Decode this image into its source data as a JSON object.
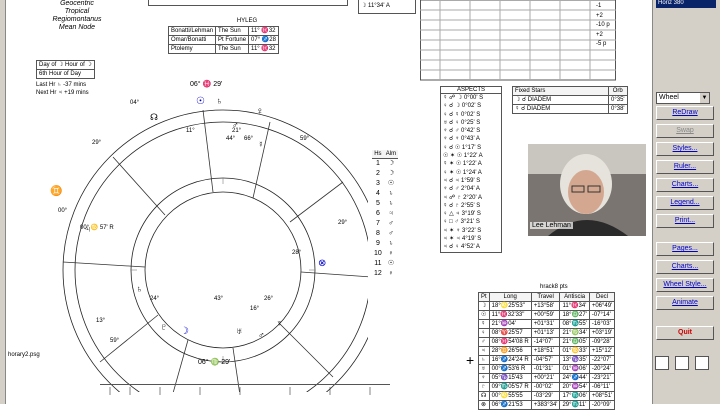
{
  "info_lines": [
    "Geocentric",
    "Tropical",
    "Regiomontanus",
    "Mean Node"
  ],
  "hyleg": {
    "title": "HYLEG",
    "rows": [
      [
        "Bonatti/Lehman",
        "The Sun",
        "11° ♓32"
      ],
      [
        "Omar/Bonatti",
        "Pt Fortune",
        "07° ♐28"
      ],
      [
        "Ptolemy",
        "The Sun",
        "11° ♓32"
      ]
    ]
  },
  "day_hour": {
    "day_label": "Day of ☽ Hour of ☽",
    "hour_label": "6th Hour of Day",
    "last_hr": "Last Hr ♄ -37 mins",
    "next_hr": "Next Hr ♃ +19 mins"
  },
  "houses": {
    "header": [
      "Hs",
      "Alm"
    ],
    "rows": [
      [
        "1",
        "☽"
      ],
      [
        "2",
        "☽"
      ],
      [
        "3",
        "☉"
      ],
      [
        "4",
        "♄"
      ],
      [
        "5",
        "♄"
      ],
      [
        "6",
        "♃"
      ],
      [
        "7",
        "♂"
      ],
      [
        "8",
        "♂"
      ],
      [
        "9",
        "♄"
      ],
      [
        "10",
        "♀"
      ],
      [
        "11",
        "☉"
      ],
      [
        "12",
        "♀"
      ]
    ]
  },
  "aspects": {
    "title": "ASPECTS",
    "rows": [
      "☿ ☍ ☽ 0°00' S",
      "♀ ☌ ☽ 0°02' S",
      "♀ ☌ ☿ 0°02' S",
      "♅ ☌ ♀ 0°25' S",
      "♆ ☌ ♂ 0°42' S",
      "♆ ☌ ♆ 0°43' A",
      "♀ ☌ ☉ 1°17' S",
      "☉ ✶ ☉ 1°22' A",
      "☿ ✶ ☉ 1°22' A",
      "♀ ✶ ☉ 1°24' A",
      "♃ ☌ ♃ 1°59' S",
      "♆ ☌ ♂ 2°04' A",
      "♃ ☍ ♇ 2°20' A",
      "☿ ☌ ♇ 2°55' S",
      "♀ △ ♃ 3°19' S",
      "♀ □ ♂ 3°21' S",
      "♃ ✶ ♆ 3°22' S",
      "♃ ✶ ♃ 4°19' S",
      "♃ ☌ ♀ 4°52' A"
    ]
  },
  "fixed_stars": {
    "header": [
      "Fixed Stars",
      "Orb"
    ],
    "rows": [
      [
        "☽ ☌ DIADEM",
        "0°35'"
      ],
      [
        "☿ ☌ DIADEM",
        "0°38'"
      ]
    ]
  },
  "planets": {
    "title": "hrack8 pts",
    "header": [
      "Pt",
      "Long",
      "Travel",
      "Antiscia",
      "Decl"
    ],
    "rows": [
      [
        "☽",
        "18°♌25'53\"",
        "+13°58'",
        "11°♓34'",
        "+06°49'"
      ],
      [
        "☉",
        "11°♓32'33\"",
        "+00°59'",
        "18°♎27'",
        "-07°14'"
      ],
      [
        "☿",
        "21°♒04'",
        "+01°31'",
        "08°♏55'",
        "-16°03'"
      ],
      [
        "♀",
        "08°♈25'57",
        "+01°13'",
        "21°♍34'",
        "+03°19'"
      ],
      [
        "♂",
        "08°♓54'08 R",
        "-14°07'",
        "21°♎05'",
        "-09°28'"
      ],
      [
        "♃",
        "28°♊26'56",
        "+18°51'",
        "01°♋33'",
        "+15°12'"
      ],
      [
        "♄",
        "16°♐24'24 R",
        "-04°57'",
        "13°♑35'",
        "-22°07'"
      ],
      [
        "♅",
        "00°♐53'6 R",
        "-01°31'",
        "01°♒06'",
        "-20°24'"
      ],
      [
        "♆",
        "05°♑15'43",
        "+00°21'",
        "24°♐44'",
        "-23°21'"
      ],
      [
        "♇",
        "09°♏05'57 R",
        "-00°02'",
        "20°♒54'",
        "-06°11'"
      ],
      [
        "☊",
        "00°♌55'55",
        "-03°29'",
        "17°♏06'",
        "+08°51'"
      ],
      [
        "⊗",
        "06°♐21'53",
        "+383°34'",
        "29°♏11'",
        "-20°09'"
      ]
    ]
  },
  "wheel": {
    "mc": "06° ♓ 29'",
    "ic": "06° ♍ 29'",
    "asc": "00° ♋ 57' R",
    "dsc": "00° ♑",
    "cusps": [
      "04°",
      "29°",
      "00°",
      "13°",
      "29°",
      "04°",
      "59°",
      "59°"
    ],
    "inner_labels": [
      "11°",
      "21°",
      "44°",
      "66°",
      "05°",
      "28°",
      "19°",
      "08°",
      "24°",
      "20°",
      "43°",
      "16°",
      "26°"
    ]
  },
  "horary_label": "horary2.psg",
  "webcam": {
    "name": "Lee Lehman"
  },
  "right_panel": {
    "top_label": "Horiz 380",
    "select": "Wheel",
    "buttons": [
      {
        "label": "ReDraw",
        "style": "blue"
      },
      {
        "label": "Swap",
        "style": "gray"
      },
      {
        "label": "Styles...",
        "style": "blue"
      },
      {
        "label": "Ruler...",
        "style": "blue"
      },
      {
        "label": "Charts...",
        "style": "blue"
      },
      {
        "label": "Legend...",
        "style": "blue"
      },
      {
        "label": "Print...",
        "style": "blue"
      },
      {
        "label": "Pages...",
        "style": "blue"
      },
      {
        "label": "Charts...",
        "style": "blue"
      },
      {
        "label": "Wheel Style...",
        "style": "blue"
      },
      {
        "label": "Animate",
        "style": "blue"
      },
      {
        "label": "Quit",
        "style": "red"
      }
    ]
  },
  "top_partial": {
    "right_values": [
      "-1",
      "+2",
      "-10 p",
      "+2",
      "-5 p"
    ],
    "moon_pos": "☽ 11°34' A"
  }
}
